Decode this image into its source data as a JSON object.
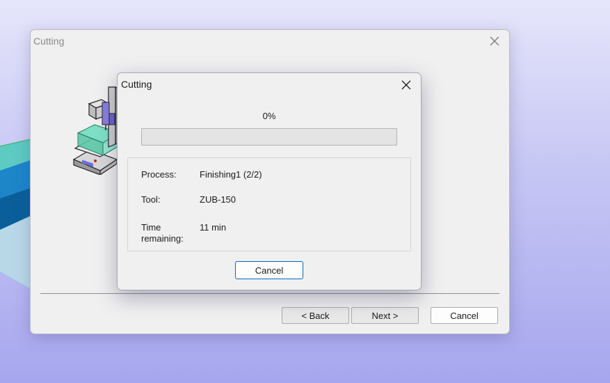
{
  "wizard": {
    "title": "Cutting",
    "back_label": "< Back",
    "next_label": "Next >",
    "cancel_label": "Cancel"
  },
  "dialog": {
    "title": "Cutting",
    "percent_text": "0%",
    "progress_fraction": 0,
    "process_label": "Process:",
    "process_value": "Finishing1 (2/2)",
    "tool_label": "Tool:",
    "tool_value": "ZUB-150",
    "time_label_line1": "Time",
    "time_label_line2": "remaining:",
    "time_value": "11 min",
    "cancel_label": "Cancel"
  },
  "colors": {
    "accent": "#0067c0",
    "progress_fill": "#06b025",
    "window_bg": "#f0f0f0"
  },
  "icons": {
    "close": "close-icon",
    "machine": "milling-machine-icon"
  }
}
